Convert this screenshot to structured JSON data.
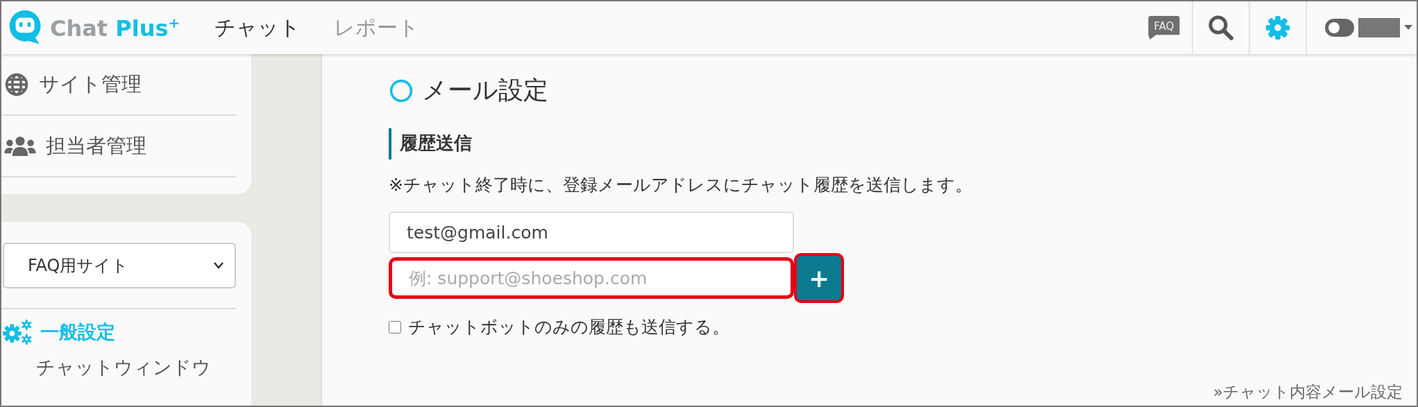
{
  "header": {
    "logo": {
      "name": "Chat ",
      "accent": "Plus",
      "sup": "+"
    },
    "nav": [
      {
        "label": "チャット",
        "selected": true
      },
      {
        "label": "レポート",
        "selected": false
      }
    ],
    "faq_badge": "FAQ"
  },
  "sidebar": {
    "top_items": [
      {
        "label": "サイト管理"
      },
      {
        "label": "担当者管理"
      }
    ],
    "site_select": {
      "value": "FAQ用サイト"
    },
    "section": {
      "label": "一般設定",
      "selected": true
    },
    "sub_items": [
      {
        "label": "チャットウィンドウ",
        "selected": false
      }
    ]
  },
  "main": {
    "title": "メール設定",
    "section_title": "履歴送信",
    "description": "※チャット終了時に、登録メールアドレスにチャット履歴を送信します。",
    "emails": [
      {
        "value": "test@gmail.com",
        "highlighted": false
      }
    ],
    "new_email": {
      "placeholder": "例: support@shoeshop.com",
      "highlighted": true
    },
    "add_button": {
      "label": "+",
      "highlighted": true
    },
    "chatbot_option": {
      "label": "チャットボットのみの履歴も送信する。",
      "checked": false
    },
    "link": "»チャット内容メール設定"
  }
}
